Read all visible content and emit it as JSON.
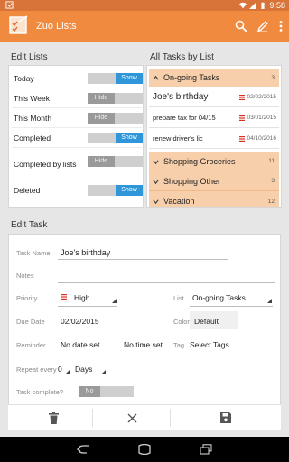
{
  "status_bar": {
    "time": "9:58"
  },
  "app_bar": {
    "title": "Zuo Lists",
    "icons": [
      "search-icon",
      "edit-icon",
      "overflow-menu-icon"
    ]
  },
  "edit_lists": {
    "title": "Edit Lists",
    "rows": [
      {
        "label": "Today",
        "state": "Show",
        "on": true
      },
      {
        "label": "This Week",
        "state": "Hide",
        "on": false
      },
      {
        "label": "This Month",
        "state": "Hide",
        "on": false
      },
      {
        "label": "Completed",
        "state": "Show",
        "on": true
      },
      {
        "label": "Completed by lists",
        "state": "Hide",
        "on": false
      },
      {
        "label": "Deleted",
        "state": "Show",
        "on": true
      }
    ]
  },
  "all_tasks": {
    "title": "All Tasks by List",
    "groups": [
      {
        "label": "On-going Tasks",
        "count": "3",
        "expanded": true,
        "tasks": [
          {
            "title": "Joe's birthday",
            "date": "02/02/2015"
          },
          {
            "title": "prepare tax for 04/15",
            "date": "03/01/2015"
          },
          {
            "title": "renew driver's lic",
            "date": "04/10/2016"
          }
        ]
      },
      {
        "label": "Shopping Groceries",
        "count": "11",
        "expanded": false
      },
      {
        "label": "Shopping Other",
        "count": "3",
        "expanded": false
      },
      {
        "label": "Vacation",
        "count": "12",
        "expanded": false
      }
    ]
  },
  "edit_task": {
    "title": "Edit Task",
    "task_name_label": "Task Name",
    "task_name_value": "Joe's birthday",
    "notes_label": "Notes",
    "notes_value": "",
    "priority_label": "Priority",
    "priority_value": "High",
    "list_label": "List",
    "list_value": "On-going Tasks",
    "due_date_label": "Due Date",
    "due_date_value": "02/02/2015",
    "color_label": "Color",
    "color_value": "Default",
    "reminder_label": "Reminder",
    "reminder_date": "No date set",
    "reminder_time": "No time set",
    "tag_label": "Tag",
    "tag_value": "Select Tags",
    "repeat_label": "Repeat every",
    "repeat_value": "0",
    "repeat_unit": "Days",
    "complete_label": "Task complete?",
    "complete_value": "No"
  },
  "actions": {
    "icons": [
      "delete-icon",
      "close-icon",
      "save-icon"
    ]
  },
  "colors": {
    "accent": "#f08a3f",
    "status": "#d8743a",
    "group_bg": "#f8cfab",
    "toggle_on": "#2f97d9",
    "priority": "#d93025"
  }
}
